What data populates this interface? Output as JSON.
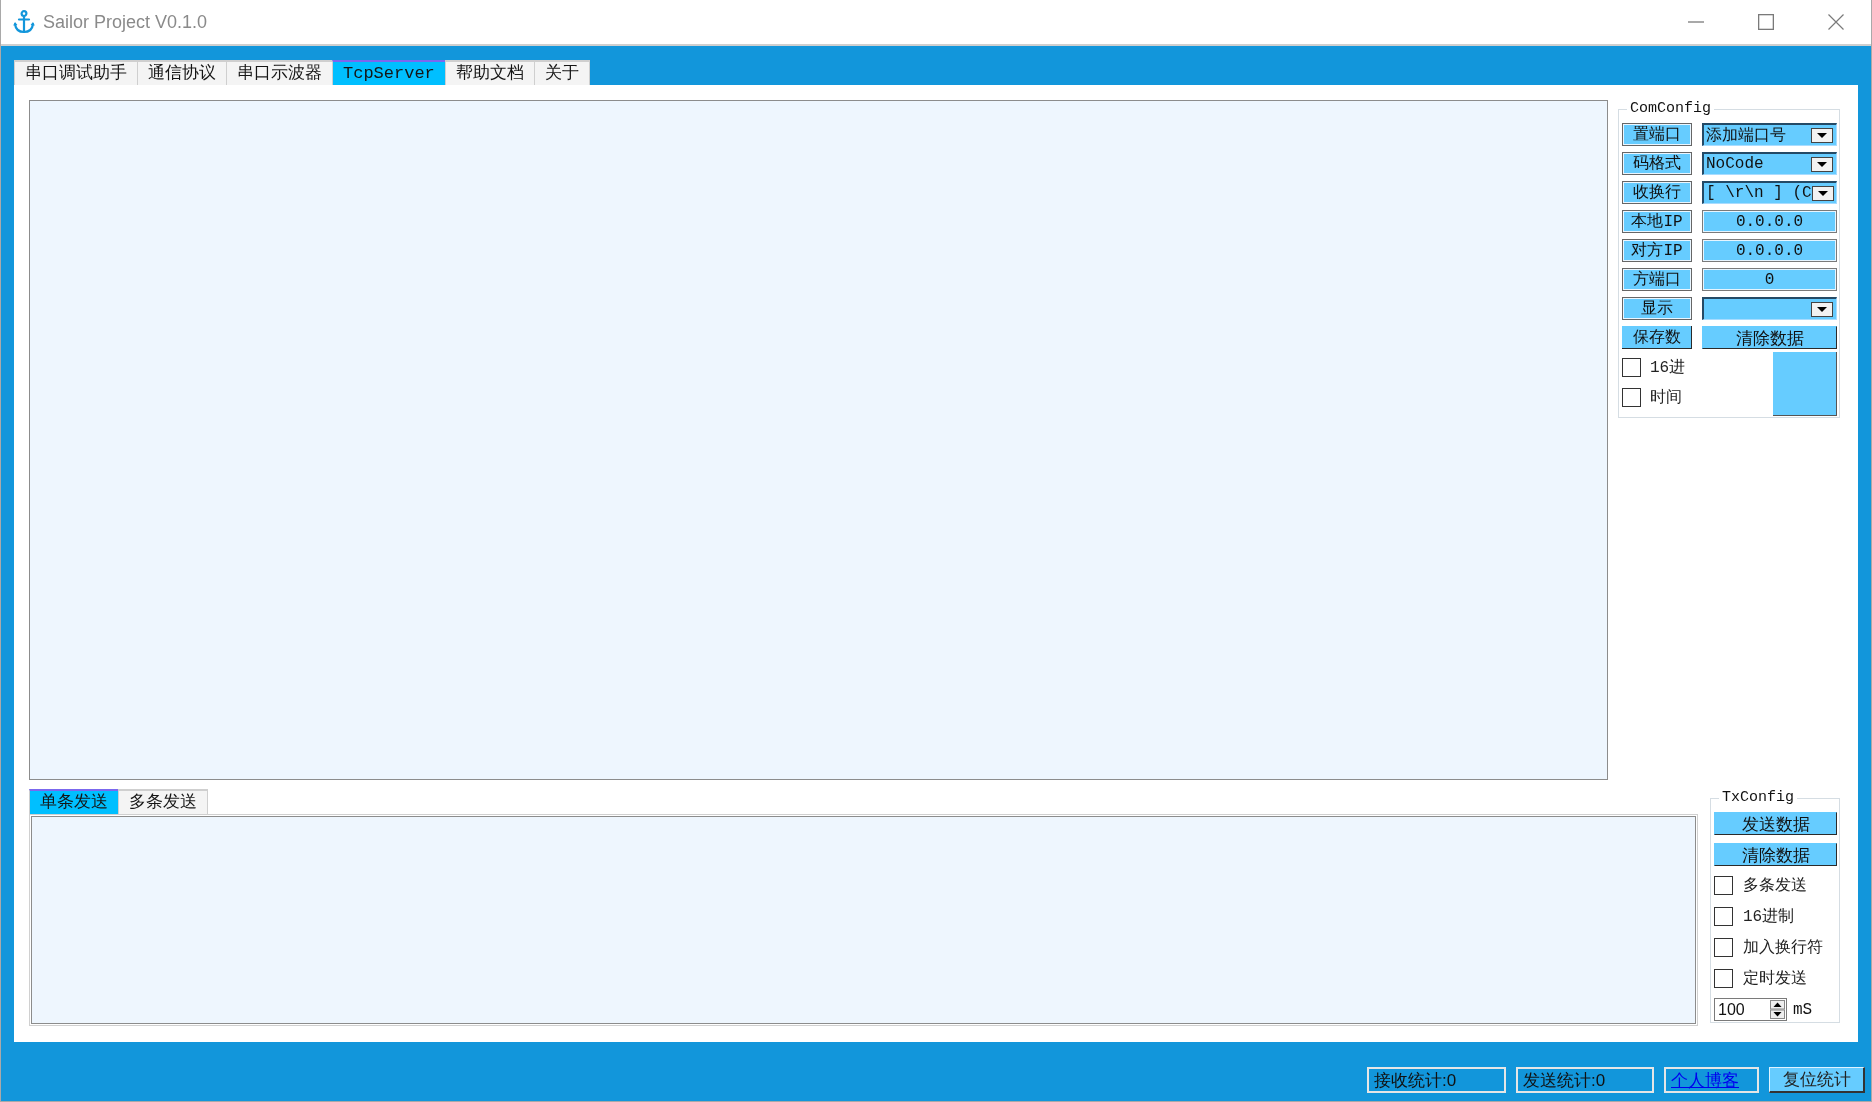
{
  "window": {
    "title": "Sailor Project V0.1.0"
  },
  "tabs": [
    {
      "label": "串口调试助手",
      "selected": false
    },
    {
      "label": "通信协议",
      "selected": false
    },
    {
      "label": "串口示波器",
      "selected": false
    },
    {
      "label": "TcpServer",
      "selected": true
    },
    {
      "label": "帮助文档",
      "selected": false
    },
    {
      "label": "关于",
      "selected": false
    }
  ],
  "com_config": {
    "title": "ComConfig",
    "rows": [
      {
        "kind": "dropdown",
        "label": "置端口",
        "value": "添加端口号"
      },
      {
        "kind": "dropdown",
        "label": "码格式",
        "value": "NoCode"
      },
      {
        "kind": "dropdown",
        "label": "收换行",
        "value": "[ \\r\\n ] (C"
      },
      {
        "kind": "field",
        "label": "本地IP",
        "value": "0.0.0.0"
      },
      {
        "kind": "field",
        "label": "对方IP",
        "value": "0.0.0.0"
      },
      {
        "kind": "field",
        "label": "方端口",
        "value": "0"
      },
      {
        "kind": "dropdown",
        "label": "显示"
      },
      {
        "kind": "button",
        "label": "保存数",
        "value": "清除数据"
      }
    ],
    "checkboxes": [
      {
        "label": "16进",
        "checked": false
      },
      {
        "label": "时间",
        "checked": false
      }
    ]
  },
  "send_tabs": [
    {
      "label": "单条发送",
      "selected": true
    },
    {
      "label": "多条发送",
      "selected": false
    }
  ],
  "tx_config": {
    "title": "TxConfig",
    "buttons": [
      "发送数据",
      "清除数据"
    ],
    "checkboxes": [
      {
        "label": "多条发送",
        "checked": false
      },
      {
        "label": "16进制",
        "checked": false
      },
      {
        "label": "加入换行符",
        "checked": false
      },
      {
        "label": "定时发送",
        "checked": false
      }
    ],
    "interval": {
      "value": "100",
      "unit": "mS"
    }
  },
  "status_bar": {
    "received": "接收统计:0",
    "sent": "发送统计:0",
    "link": "个人博客",
    "reset_button": "复位统计"
  }
}
